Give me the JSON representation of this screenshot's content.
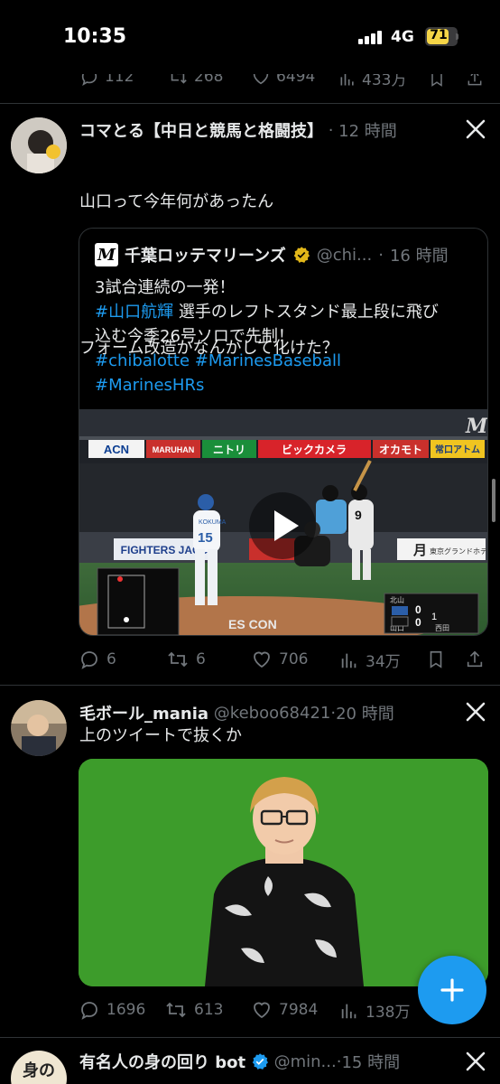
{
  "status_bar": {
    "time": "10:35",
    "network": "4G",
    "battery": "71",
    "battery_color": "#f5d547"
  },
  "prev_tweet_actions": {
    "replies": "112",
    "retweets": "268",
    "likes": "6494",
    "views": "433万"
  },
  "tweets": [
    {
      "author": "コマとる【中日と競馬と格闘技】",
      "time": "12 時間",
      "text_lines": [
        "山口って今年何があったん",
        "",
        "フォーム改造かなんかして化けた？"
      ],
      "quote": {
        "author": "千葉ロッテマリーンズ",
        "handle": "@chi...",
        "time": "16 時間",
        "logo_letter": "M",
        "line1": "3試合連続の一発！",
        "line2_tag": "#山口航輝",
        "line2_rest": " 選手のレフトスタンド最上段に飛び",
        "line3": "込む今季26号ソロで先制！",
        "line4_tag1": "#chibalotte",
        "line4_tag2": "#MarinesBaseball",
        "line5_tag": "#MarinesHRs",
        "video": {
          "banner_1": "ACN",
          "banner_2": "MARUHAN",
          "banner_3": "ニトリ",
          "banner_4": "ビックカメラ",
          "banner_5": "オカモト",
          "banner_6": "常口アトム",
          "ad_fighters": "FIGHTERS JACC",
          "ad_right": "月",
          "ad_right_sub": "東京グランドホテル",
          "wall_text": "ES CON",
          "pitcher_name": "KOKUMA",
          "pitcher_number": "15",
          "batter_number": "9",
          "score_team_a": "北山",
          "score_team_b": "山口",
          "score_a": "0",
          "score_b": "0",
          "inning": "1",
          "catcher": "西田"
        }
      },
      "actions": {
        "replies": "6",
        "retweets": "6",
        "likes": "706",
        "views": "34万"
      }
    },
    {
      "author": "毛ボール_mania",
      "handle": "@keboo68421",
      "time": "20 時間",
      "text_lines": [
        "上のツイートで抜くか"
      ],
      "actions": {
        "replies": "1696",
        "retweets": "613",
        "likes": "7984",
        "views": "138万"
      }
    },
    {
      "author": "有名人の身の回り bot",
      "handle": "@min...",
      "time": "15 時間",
      "avatar_text": "身の"
    }
  ],
  "colors": {
    "accent": "#1d9bf0",
    "muted": "#71767b",
    "background": "#000000",
    "text": "#e7e9ea",
    "verified_gold": "#e2b719",
    "greenscreen": "#3d9c2b"
  }
}
